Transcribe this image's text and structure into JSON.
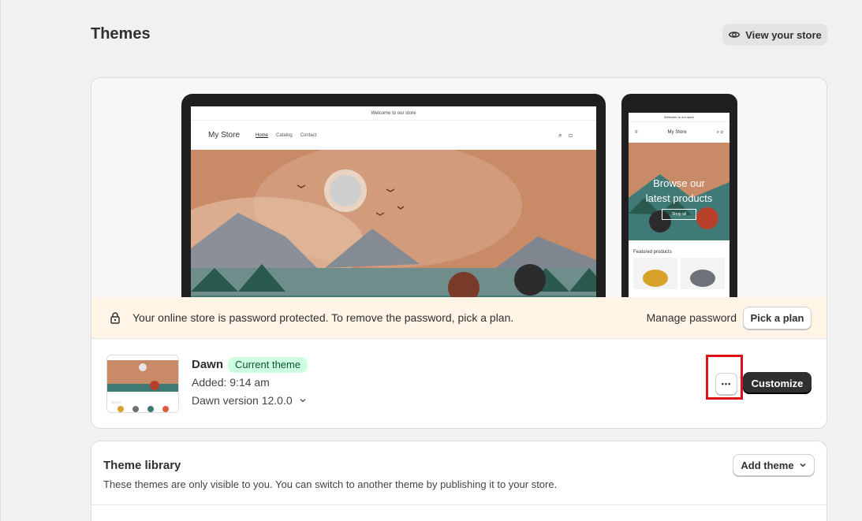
{
  "header": {
    "title": "Themes",
    "view_store_label": "View your store"
  },
  "preview": {
    "desktop": {
      "announcement": "Welcome to our store",
      "brand": "My Store",
      "nav": [
        "Home",
        "Catalog",
        "Contact"
      ]
    },
    "mobile": {
      "announcement": "Welcome to our store",
      "brand": "My Store",
      "hero_line1": "Browse our",
      "hero_line2": "latest products",
      "hero_button": "Shop all",
      "featured_heading": "Featured products"
    }
  },
  "banner": {
    "message": "Your online store is password protected. To remove the password, pick a plan.",
    "manage_password": "Manage password",
    "pick_plan": "Pick a plan"
  },
  "current_theme": {
    "name": "Dawn",
    "badge": "Current theme",
    "added": "Added: 9:14 am",
    "version": "Dawn version 12.0.0",
    "more_label": "•••",
    "customize_label": "Customize"
  },
  "library": {
    "title": "Theme library",
    "description": "These themes are only visible to you. You can switch to another theme by publishing it to your store.",
    "add_theme_label": "Add theme"
  },
  "colors": {
    "badge_bg": "#cdfee1",
    "banner_bg": "#fff4e6",
    "primary_button": "#303030",
    "highlight": "#e0101a"
  }
}
